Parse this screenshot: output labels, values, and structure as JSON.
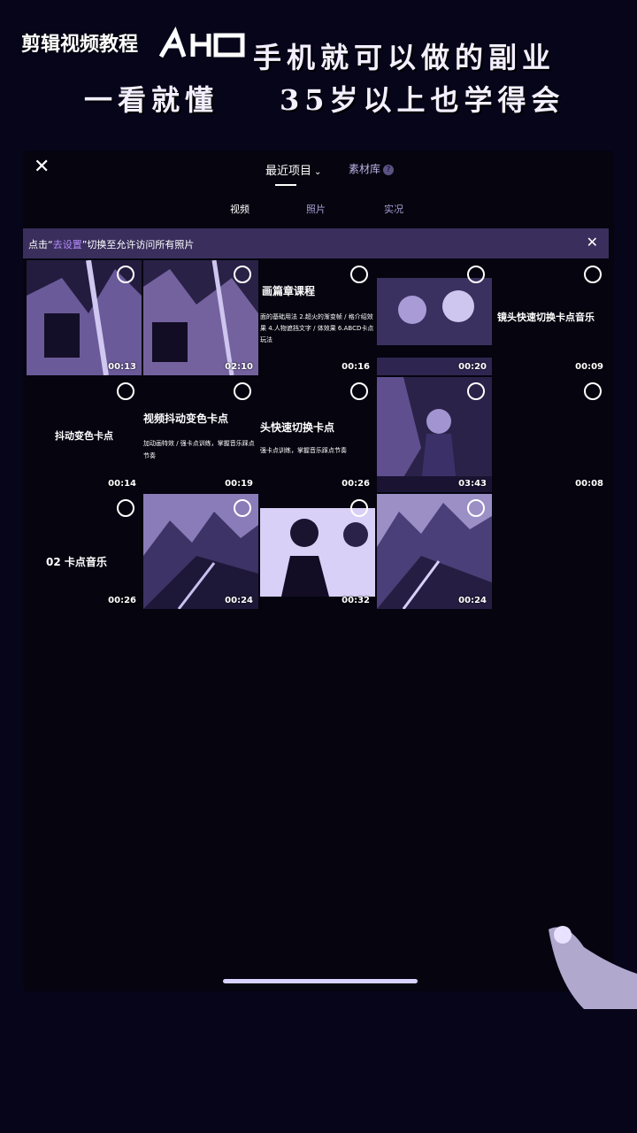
{
  "overlay": {
    "channel_title": "剪辑视频教程",
    "headline_1": "手机就可以做的副业",
    "headline_2a": "一看就懂",
    "headline_2b": "35岁以上也学得会"
  },
  "app": {
    "tabs": {
      "recent": "最近项目",
      "library": "素材库",
      "help": "?"
    },
    "segments": [
      "视频",
      "照片",
      "实况"
    ],
    "banner": {
      "prefix": "点击“",
      "link": "去设置",
      "suffix": "”切换至允许访问所有照片"
    }
  },
  "grid": [
    {
      "duration": "00:13",
      "title": "",
      "sub": ""
    },
    {
      "duration": "02:10",
      "title": "",
      "sub": ""
    },
    {
      "duration": "00:16",
      "title": "画篇章课程",
      "sub": "面的基础用法  2.超火的渐变帧 / 格介绍效果  4.人物遮挡文字 / 体效果  6.ABCD卡点玩法"
    },
    {
      "duration": "00:20",
      "title": "",
      "sub": ""
    },
    {
      "duration": "00:09",
      "title": "镜头快速切换卡点音乐",
      "sub": ""
    },
    {
      "duration": "00:14",
      "title": "抖动变色卡点",
      "sub": ""
    },
    {
      "duration": "00:19",
      "title": "视频抖动变色卡点",
      "sub": "加动画特效 / 强卡点训练，掌握音乐踩点节奏"
    },
    {
      "duration": "00:26",
      "title": "头快速切换卡点",
      "sub": "强卡点训练，掌握音乐踩点节奏"
    },
    {
      "duration": "03:43",
      "title": "",
      "sub": ""
    },
    {
      "duration": "00:08",
      "title": "",
      "sub": ""
    },
    {
      "duration": "00:26",
      "title": "02 卡点音乐",
      "sub": ""
    },
    {
      "duration": "00:24",
      "title": "",
      "sub": ""
    },
    {
      "duration": "00:32",
      "title": "",
      "sub": ""
    },
    {
      "duration": "00:24",
      "title": "",
      "sub": ""
    }
  ],
  "icons": [
    "close-icon",
    "chevron-down-icon",
    "help-icon",
    "select-circle-icon"
  ],
  "colors": {
    "background": "#07051a",
    "banner": "#3a2f5c",
    "accent": "#b58bff"
  }
}
